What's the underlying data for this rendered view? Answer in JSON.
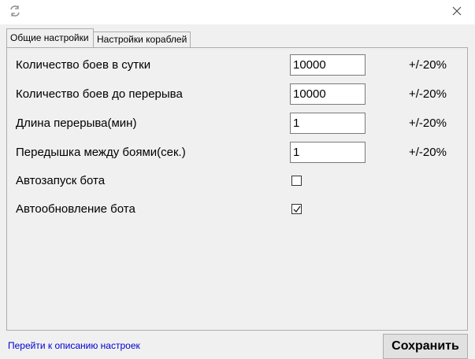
{
  "window": {
    "app_icon": "refresh-icon",
    "close_icon": "close-icon"
  },
  "tabs": [
    {
      "label": "Общие настройки",
      "active": true
    },
    {
      "label": "Настройки кораблей",
      "active": false
    }
  ],
  "settings": {
    "battles_per_day": {
      "label": "Количество боев в сутки",
      "value": "10000",
      "range": "+/-20%"
    },
    "battles_before_break": {
      "label": "Количество боев до перерыва",
      "value": "10000",
      "range": "+/-20%"
    },
    "break_length": {
      "label": "Длина перерыва(мин)",
      "value": "1",
      "range": "+/-20%"
    },
    "pause_between_battles": {
      "label": "Передышка между боями(сек.)",
      "value": "1",
      "range": "+/-20%"
    },
    "autostart": {
      "label": "Автозапуск бота",
      "checked": false
    },
    "autoupdate": {
      "label": "Автообновление бота",
      "checked": true
    }
  },
  "footer": {
    "link": "Перейти к описанию настроек",
    "save_label": "Сохранить"
  }
}
